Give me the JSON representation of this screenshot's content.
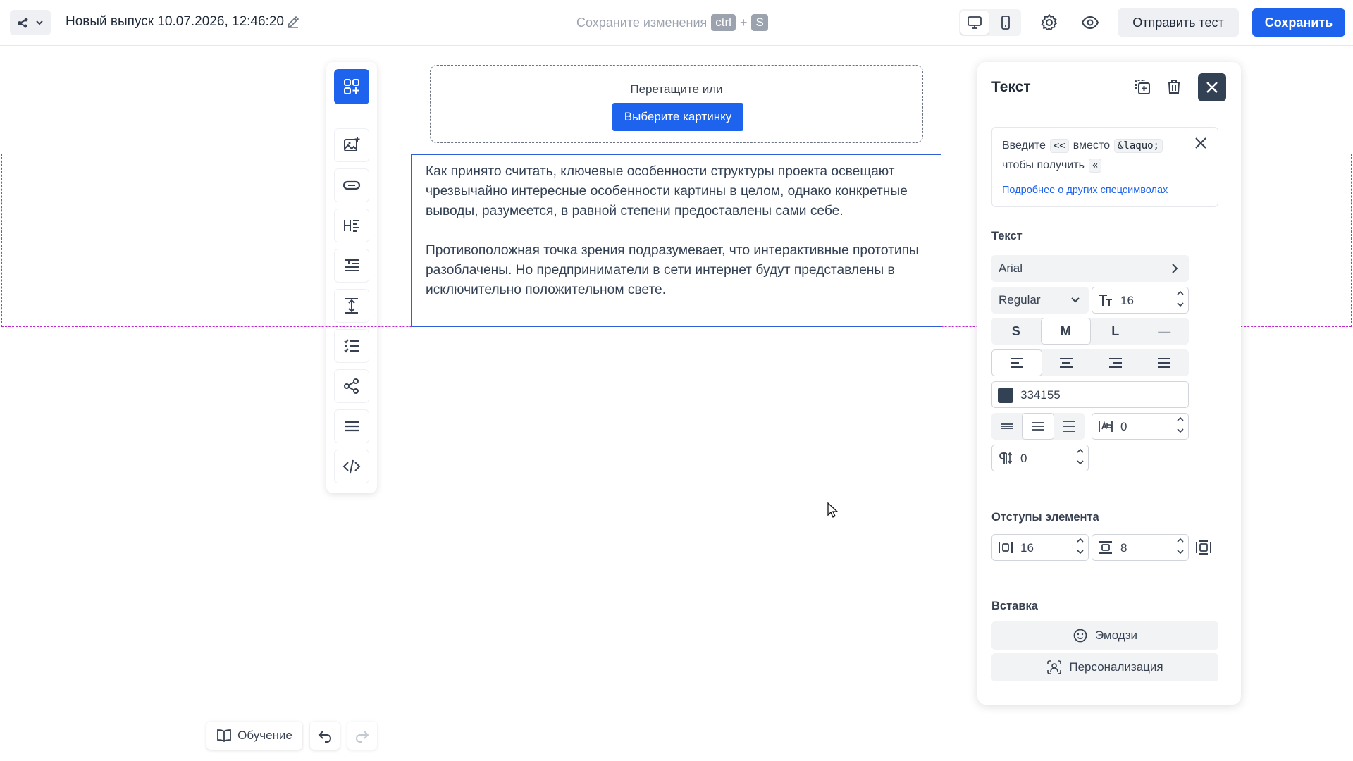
{
  "header": {
    "title": "Новый выпуск 10.07.2026, 12:46:20",
    "save_hint": "Сохраните изменения",
    "kbd_ctrl": "ctrl",
    "kbd_plus": "+",
    "kbd_s": "S",
    "send_test_label": "Отправить тест",
    "save_label": "Сохранить",
    "active_device": "desktop"
  },
  "canvas": {
    "image_drop_text": "Перетащите или",
    "image_pick_label": "Выберите картинку",
    "paragraphs": [
      "Как принято считать, ключевые особенности структуры проекта освещают чрезвычайно интересные особенности картины в целом, однако конкретные выводы, разумеется, в равной степени предоставлены сами себе.",
      "Противоположная точка зрения подразумевает, что интерактивные прототипы разоблачены. Но предприниматели в сети интернет будут представлены в исключительно положительном свете."
    ]
  },
  "toolbar": {
    "icons": [
      "blocks-icon",
      "image-add-icon",
      "button-icon",
      "heading-icon",
      "text-icon",
      "spacer-icon",
      "list-icon",
      "social-icon",
      "divider-icon",
      "html-code-icon"
    ]
  },
  "panel": {
    "title": "Текст",
    "note": {
      "enter": "Введите",
      "code_1": "<<",
      "instead_of": "вместо",
      "code_2": "&laquo;",
      "to_get": "чтобы получить",
      "code_3": "«",
      "link": "Подробнее о других спецсимволах"
    },
    "text_section_label": "Текст",
    "font_family": "Arial",
    "font_weight": "Regular",
    "font_size": "16",
    "sizes": [
      "S",
      "M",
      "L",
      "—"
    ],
    "active_size": "M",
    "text_color": "334155",
    "color_swatch": "#334155",
    "letter_spacing": "0",
    "paragraph_spacing": "0",
    "padding_label": "Отступы элемента",
    "padding_horizontal": "16",
    "padding_vertical": "8",
    "insert_label": "Вставка",
    "emoji_label": "Эмодзи",
    "personalization_label": "Персонализация"
  },
  "footer": {
    "learn_label": "Обучение"
  },
  "colors": {
    "accent": "#1d63ed",
    "text": "#334155",
    "row_outline": "#c026d3"
  }
}
